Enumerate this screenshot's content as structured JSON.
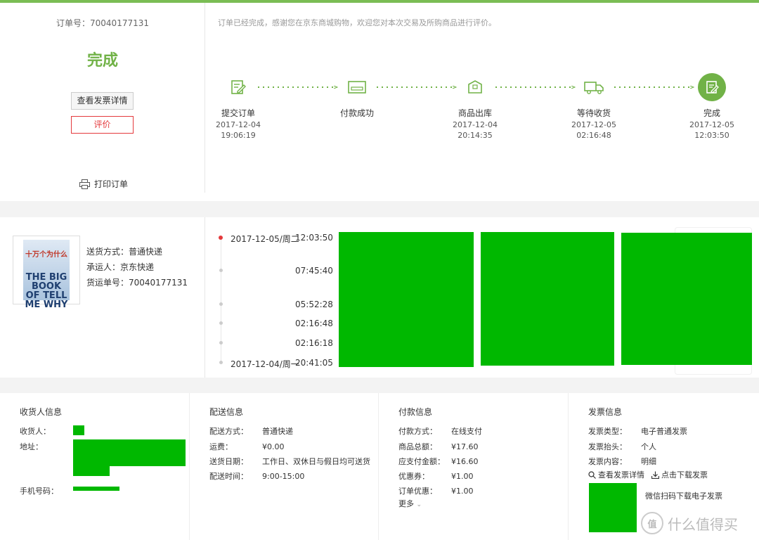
{
  "order": {
    "order_no_label": "订单号：",
    "order_no": "70040177131",
    "status": "完成",
    "invoice_button": "查看发票详情",
    "review_button": "评价",
    "print_label": "打印订单",
    "thanks_message": "订单已经完成，感谢您在京东商城购物，欢迎您对本次交易及所购商品进行评价。"
  },
  "progress": {
    "steps": [
      {
        "label": "提交订单",
        "date": "2017-12-04",
        "time": "19:06:19",
        "icon": "edit-icon"
      },
      {
        "label": "付款成功",
        "date": "",
        "time": "",
        "icon": "card-icon"
      },
      {
        "label": "商品出库",
        "date": "2017-12-04",
        "time": "20:14:35",
        "icon": "box-icon"
      },
      {
        "label": "等待收货",
        "date": "2017-12-05",
        "time": "02:16:48",
        "icon": "truck-icon"
      },
      {
        "label": "完成",
        "date": "2017-12-05",
        "time": "12:03:50",
        "icon": "check-doc-icon"
      }
    ],
    "accent": "#71b247"
  },
  "shipment": {
    "method_label": "送货方式：普通快递",
    "carrier_label": "承运人：京东快递",
    "tracking_label": "货运单号：70040177131",
    "book_title": "十万个为什么",
    "book_subtitle": "THE BIG BOOK OF TELL ME WHY",
    "timeline": [
      {
        "date": "2017-12-05/周二",
        "time": "12:03:50"
      },
      {
        "date": "",
        "time": "07:45:40"
      },
      {
        "date": "",
        "time": "05:52:28"
      },
      {
        "date": "",
        "time": "02:16:48"
      },
      {
        "date": "",
        "time": "02:16:18"
      },
      {
        "date": "2017-12-04/周一",
        "time": "20:41:05"
      }
    ]
  },
  "info": {
    "receiver": {
      "title": "收货人信息",
      "name_label": "收货人：",
      "address_label": "地址：",
      "phone_label": "手机号码："
    },
    "delivery": {
      "title": "配送信息",
      "rows": [
        {
          "k": "配送方式：",
          "v": "普通快递"
        },
        {
          "k": "运费：",
          "v": "¥0.00"
        },
        {
          "k": "送货日期：",
          "v": "工作日、双休日与假日均可送货"
        },
        {
          "k": "配送时间：",
          "v": "9:00-15:00"
        }
      ]
    },
    "payment": {
      "title": "付款信息",
      "rows": [
        {
          "k": "付款方式：",
          "v": "在线支付"
        },
        {
          "k": "商品总额：",
          "v": "¥17.60"
        },
        {
          "k": "应支付金额：",
          "v": "¥16.60"
        },
        {
          "k": "优惠券：",
          "v": "¥1.00"
        },
        {
          "k": "订单优惠：",
          "v": "¥1.00"
        }
      ],
      "more": "更多"
    },
    "invoice": {
      "title": "发票信息",
      "rows": [
        {
          "k": "发票类型：",
          "v": "电子普通发票"
        },
        {
          "k": "发票抬头：",
          "v": "个人"
        },
        {
          "k": "发票内容：",
          "v": "明细"
        }
      ],
      "view_link": "查看发票详情",
      "download_link": "点击下载发票",
      "wechat_text": "微信扫码下载电子发票"
    }
  },
  "watermark": {
    "text": "什么值得买",
    "badge": "值"
  },
  "colors": {
    "green": "#71b247",
    "red": "#e4393c",
    "mask": "#00b800"
  }
}
